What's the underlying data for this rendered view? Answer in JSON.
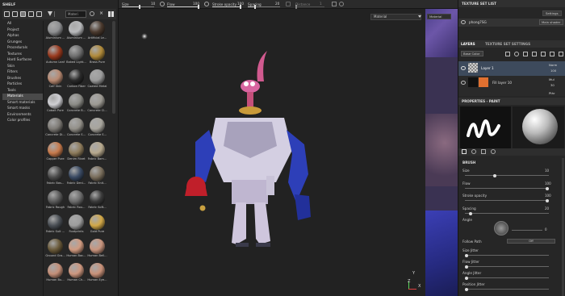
{
  "topbar": {
    "size_label": "Size",
    "size_value": "10",
    "flow_label": "Flow",
    "flow_value": "100",
    "stroke_label": "Stroke opacity",
    "stroke_value": "100",
    "spacing_label": "Spacing",
    "spacing_value": "20",
    "distance_label": "Distance",
    "distance_value": "1",
    "size_fraction": 0.55,
    "flow_fraction": 1.0,
    "stroke_fraction": 1.0,
    "spacing_fraction": 0.2
  },
  "shelf": {
    "title": "SHELF",
    "search_value": "Materi",
    "categories": [
      "All",
      "Project",
      "Alphas",
      "Grunges",
      "Procedurals",
      "Textures",
      "Hard Surfaces",
      "Skin",
      "Filters",
      "Brushes",
      "Particles",
      "Tools",
      "Materials",
      "Smart materials",
      "Smart masks",
      "Environments",
      "Color profiles"
    ],
    "selected_category": "Materials",
    "materials": [
      {
        "name": "Aluminium ...",
        "color": "#8f9092"
      },
      {
        "name": "Aluminium ...",
        "color": "#b9babc"
      },
      {
        "name": "Artificial Le...",
        "color": "#4b3a2e"
      },
      {
        "name": "Autumn Leaf",
        "color": "#9a3a1e"
      },
      {
        "name": "Baked Light...",
        "color": "#6e6e6e"
      },
      {
        "name": "Brass Pure",
        "color": "#b08a3a"
      },
      {
        "name": "Calf Skin",
        "color": "#b98a72"
      },
      {
        "name": "Carbon Fiber",
        "color": "#2a2a2a"
      },
      {
        "name": "Coated Metal",
        "color": "#9c9c9c"
      },
      {
        "name": "Cobalt Pure",
        "color": "#cfcfd3"
      },
      {
        "name": "Concrete B...",
        "color": "#8b8b86"
      },
      {
        "name": "Concrete Cl...",
        "color": "#9d9a93"
      },
      {
        "name": "Concrete Di...",
        "color": "#7e7b76"
      },
      {
        "name": "Concrete S...",
        "color": "#939089"
      },
      {
        "name": "Concrete S...",
        "color": "#a8a59d"
      },
      {
        "name": "Copper Pure",
        "color": "#c77a4c"
      },
      {
        "name": "Denim Rivet",
        "color": "#8e7c5c"
      },
      {
        "name": "Fabric Bam...",
        "color": "#b7a98e"
      },
      {
        "name": "Fabric Bas...",
        "color": "#4c4c4c"
      },
      {
        "name": "Fabric Deni...",
        "color": "#3a4a63"
      },
      {
        "name": "Fabric Knit...",
        "color": "#7a6e5c"
      },
      {
        "name": "Fabric Rough",
        "color": "#5b5b5b"
      },
      {
        "name": "Fabric Rou...",
        "color": "#6d6d6d"
      },
      {
        "name": "Fabric Soft...",
        "color": "#3b3b3b"
      },
      {
        "name": "Fabric Suit ...",
        "color": "#4a4f55"
      },
      {
        "name": "Footprints",
        "color": "#9d9d9d"
      },
      {
        "name": "Gold Pure",
        "color": "#d2a848"
      },
      {
        "name": "Ground Gra...",
        "color": "#6a5a3a"
      },
      {
        "name": "Human Bac...",
        "color": "#d09a80"
      },
      {
        "name": "Human Bell...",
        "color": "#c9957e"
      },
      {
        "name": "Human Bu...",
        "color": "#c48f78"
      },
      {
        "name": "Human Ch...",
        "color": "#cd977f"
      },
      {
        "name": "Human Eye...",
        "color": "#c89179"
      }
    ]
  },
  "viewport": {
    "mode_dropdown": "Material",
    "axis_z": "Z",
    "axis_x": "X",
    "axis_y": "Y"
  },
  "uv_view": {
    "mode_dropdown": "Material"
  },
  "texture_set_list": {
    "title": "TEXTURE SET LIST",
    "settings_button": "Settings",
    "item_name": "phong7SG",
    "item_shader": "Main shader"
  },
  "layers": {
    "tab_layers": "LAYERS",
    "tab_texture_set_settings": "TEXTURE SET SETTINGS",
    "channel_dropdown": "Base Color",
    "items": [
      {
        "name": "Layer 1",
        "blend": "Norm",
        "opacity": "100"
      },
      {
        "name": "Fill layer 10",
        "blend": "Mul",
        "opacity": "30"
      },
      {
        "name": "",
        "blend": "Pthr",
        "opacity": ""
      }
    ]
  },
  "properties": {
    "title": "PROPERTIES - PAINT",
    "section_brush": "BRUSH",
    "size_label": "Size",
    "size_value": "10",
    "flow_label": "Flow",
    "flow_value": "100",
    "stroke_label": "Stroke opacity",
    "stroke_value": "100",
    "spacing_label": "Spacing",
    "spacing_value": "20",
    "angle_label": "Angle",
    "angle_value": "0",
    "follow_path_label": "Follow Path",
    "follow_path_value": "Off",
    "size_jitter_label": "Size Jitter",
    "flow_jitter_label": "Flow Jitter",
    "angle_jitter_label": "Angle Jitter",
    "position_jitter_label": "Position Jitter"
  },
  "colors": {
    "accent": "#e07030",
    "selected_row": "#3d4a5c"
  }
}
